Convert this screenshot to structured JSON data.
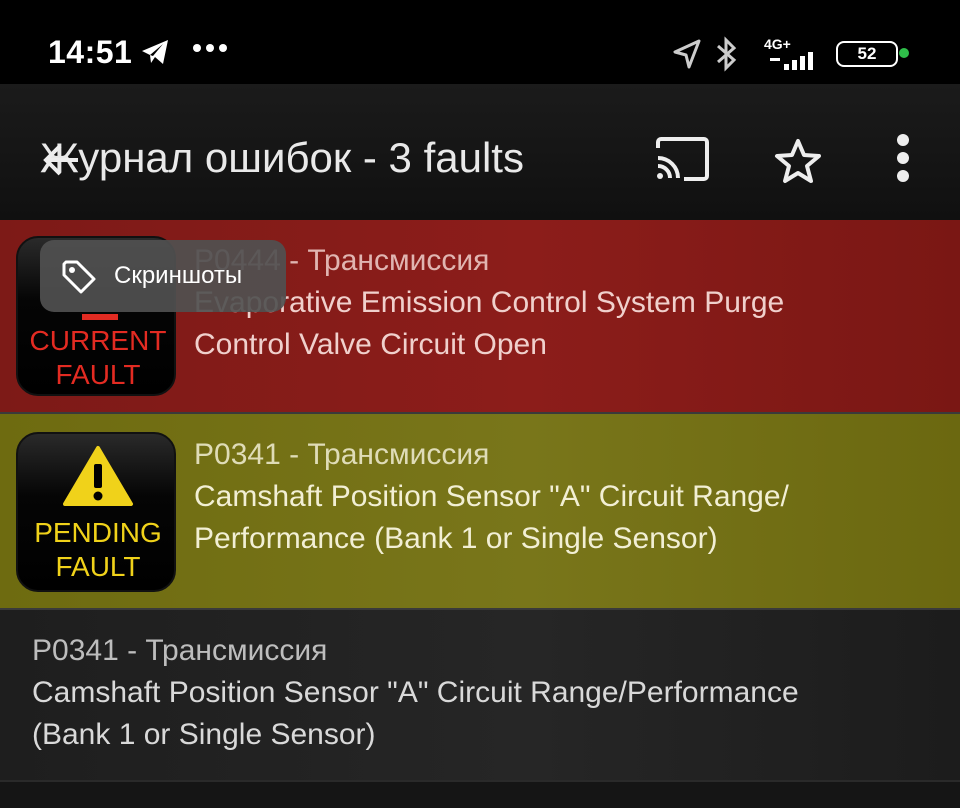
{
  "status_bar": {
    "time": "14:51",
    "network": "4G+",
    "battery": "52",
    "icons": [
      "telegram-icon",
      "more-dots-icon",
      "location-icon",
      "bluetooth-icon",
      "signal-icon",
      "battery-icon"
    ]
  },
  "app_bar": {
    "title": "Журнал ошибок - 3 faults",
    "icons": [
      "back-arrow-icon",
      "cast-icon",
      "star-icon",
      "overflow-menu-icon"
    ]
  },
  "tooltip": {
    "label": "Скриншоты",
    "icon": "tag-icon"
  },
  "faults": [
    {
      "code": "P0444 - Трансмиссия",
      "description_line1": "Evaporative Emission Control System Purge",
      "description_line2": "Control Valve Circuit Open",
      "badge_line1": "CURRENT",
      "badge_line2": "FAULT",
      "status_color": "#8c1d1a"
    },
    {
      "code": "P0341 - Трансмиссия",
      "description_line1": "Camshaft Position Sensor \"A\" Circuit Range/",
      "description_line2": "Performance (Bank 1 or Single Sensor)",
      "badge_line1": "PENDING",
      "badge_line2": "FAULT",
      "status_color": "#79761a"
    },
    {
      "code": "P0341 - Трансмиссия",
      "description_line1": "Camshaft Position Sensor \"A\" Circuit Range/Performance",
      "description_line2": "(Bank 1 or Single Sensor)"
    }
  ]
}
